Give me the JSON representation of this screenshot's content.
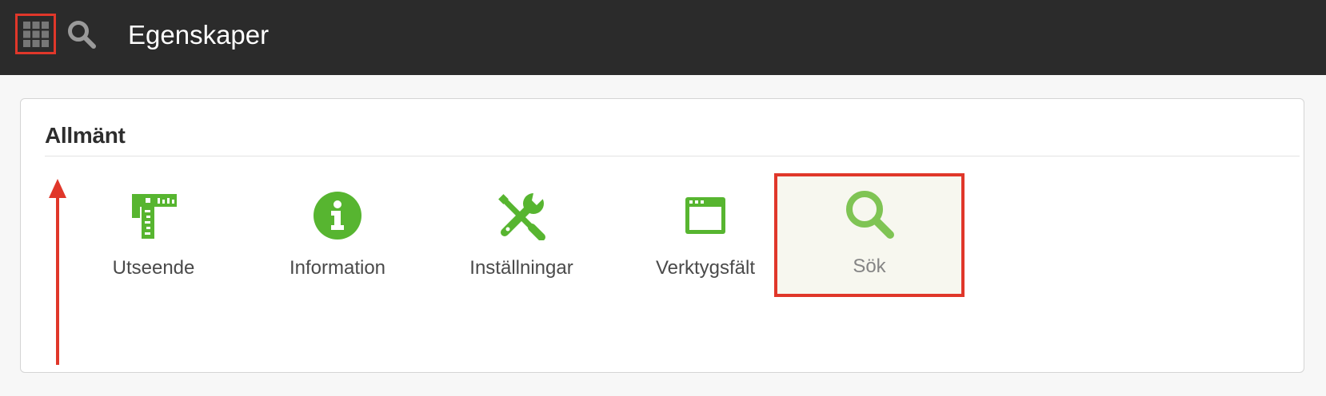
{
  "header": {
    "title": "Egenskaper",
    "icons": {
      "apps": "apps-grid-icon",
      "search": "search-icon"
    }
  },
  "section": {
    "title": "Allmänt",
    "modules": [
      {
        "label": "Utseende",
        "icon": "ruler-layout-icon"
      },
      {
        "label": "Information",
        "icon": "info-circle-icon"
      },
      {
        "label": "Inställningar",
        "icon": "tools-icon"
      },
      {
        "label": "Verktygsfält",
        "icon": "browser-window-icon"
      },
      {
        "label": "Sök",
        "icon": "search-icon",
        "selected": true
      }
    ]
  },
  "annotations": {
    "highlight_color": "#e0372a",
    "arrow": "up-arrow-annotation"
  },
  "colors": {
    "topbar": "#2b2b2b",
    "accent_green": "#57b530",
    "search_green": "#7fc454"
  }
}
